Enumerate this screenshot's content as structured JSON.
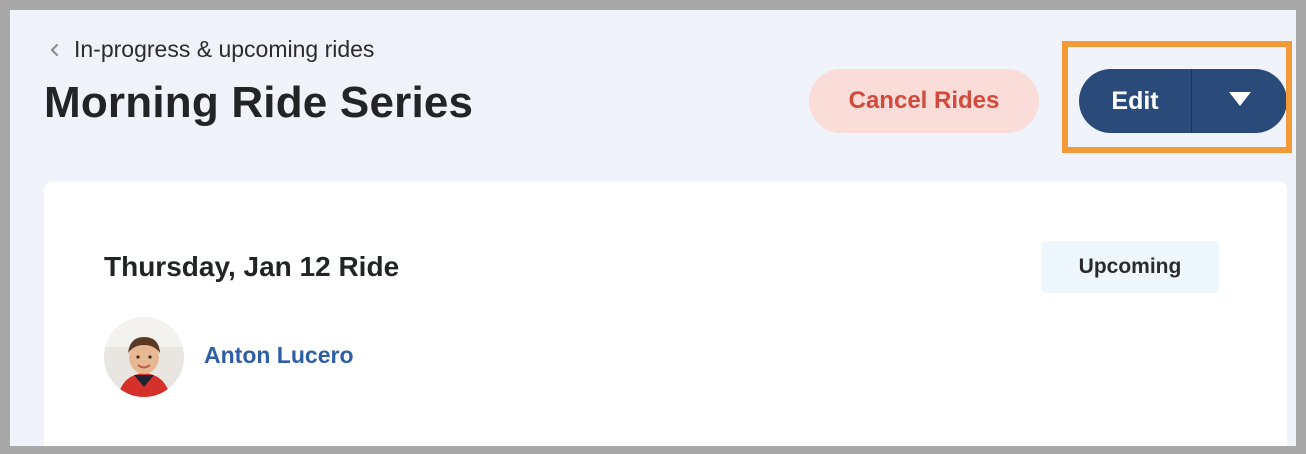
{
  "header": {
    "breadcrumb_label": "In-progress & upcoming rides",
    "breadcrumb_icon": "chevron-left-icon",
    "title": "Morning Ride Series"
  },
  "actions": {
    "cancel_label": "Cancel Rides",
    "edit_label": "Edit",
    "dropdown_icon": "caret-down-icon"
  },
  "ride": {
    "title": "Thursday, Jan 12 Ride",
    "status": "Upcoming",
    "rider": {
      "name": "Anton Lucero",
      "avatar": "child-photo-avatar"
    }
  },
  "colors": {
    "page_bg": "#f0f3f9",
    "primary": "#2a4a79",
    "danger_text": "#d14a3b",
    "danger_bg": "#fadcd8",
    "highlight": "#f2993a",
    "link": "#2f5ea8",
    "badge_bg": "#eef8fc"
  }
}
